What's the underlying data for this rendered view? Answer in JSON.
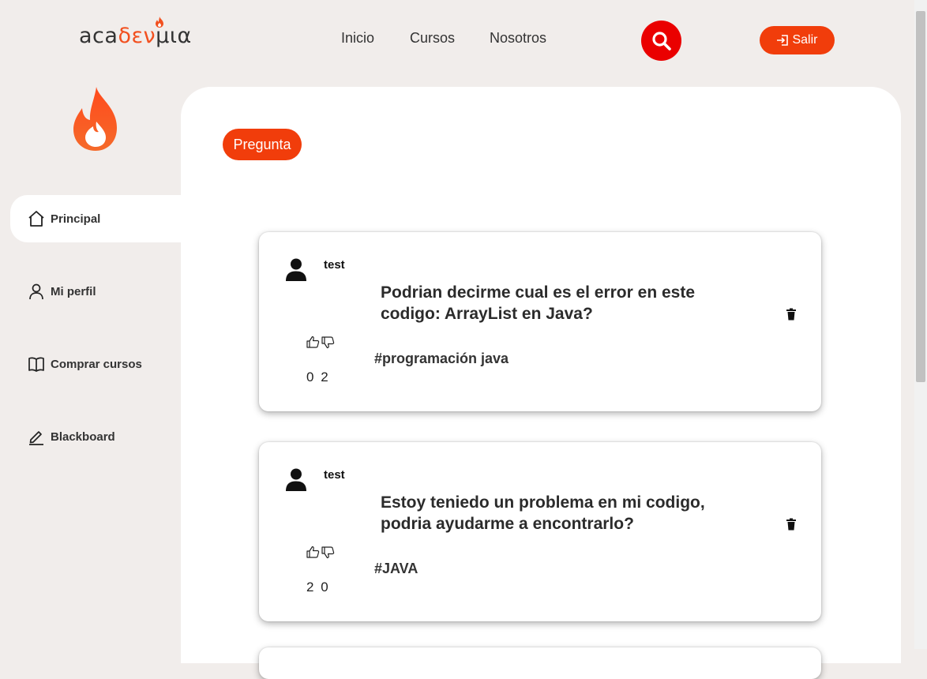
{
  "header": {
    "logo_text_dark1": "aca",
    "logo_text_red": "δεν",
    "logo_text_dark2": "μια",
    "nav": [
      "Inicio",
      "Cursos",
      "Nosotros"
    ],
    "logout_label": "Salir",
    "search_icon": "search-icon",
    "accent_color": "#f13d0b"
  },
  "sidebar": {
    "items": [
      {
        "label": "Principal",
        "icon": "home-icon",
        "active": true
      },
      {
        "label": "Mi perfil",
        "icon": "user-icon"
      },
      {
        "label": "Comprar cursos",
        "icon": "book-icon"
      },
      {
        "label": "Blackboard",
        "icon": "pencil-icon"
      }
    ]
  },
  "main": {
    "ask_button": "Pregunta",
    "questions": [
      {
        "author": "test",
        "title": "Podrian decirme cual es el error en este codigo: ArrayList en Java?",
        "tag": "#programación java",
        "likes": "0",
        "dislikes": "2"
      },
      {
        "author": "test",
        "title": "Estoy teniedo un problema en mi codigo, podria ayudarme a encontrarlo?",
        "tag": "#JAVA",
        "likes": "2",
        "dislikes": "0"
      }
    ]
  }
}
